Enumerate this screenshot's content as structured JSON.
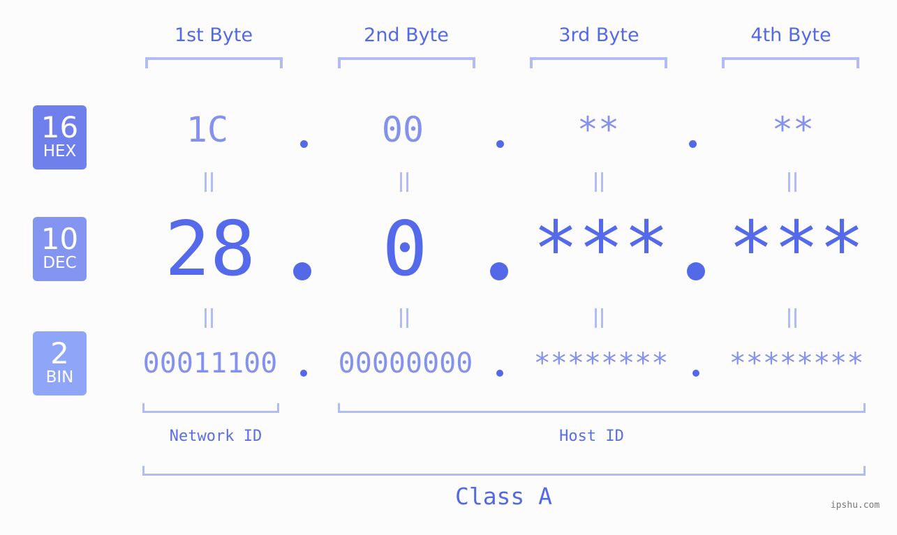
{
  "byte_headers": [
    "1st Byte",
    "2nd Byte",
    "3rd Byte",
    "4th Byte"
  ],
  "bases": [
    {
      "number": "16",
      "label": "HEX",
      "color": "#6f80ec"
    },
    {
      "number": "10",
      "label": "DEC",
      "color": "#8495f1"
    },
    {
      "number": "2",
      "label": "BIN",
      "color": "#8fa5f7"
    }
  ],
  "ip": {
    "hex": [
      "1C",
      "00",
      "**",
      "**"
    ],
    "dec": [
      "28",
      "0",
      "***",
      "***"
    ],
    "bin": [
      "00011100",
      "00000000",
      "********",
      "********"
    ],
    "separator": "."
  },
  "segments": {
    "network_id": "Network ID",
    "host_id": "Host ID"
  },
  "ip_class": "Class A",
  "watermark": "ipshu.com",
  "colors": {
    "accent": "#5469e6",
    "light_value": "#8592ed",
    "bracket": "#b1bbf4",
    "background": "#fbfcfb"
  }
}
